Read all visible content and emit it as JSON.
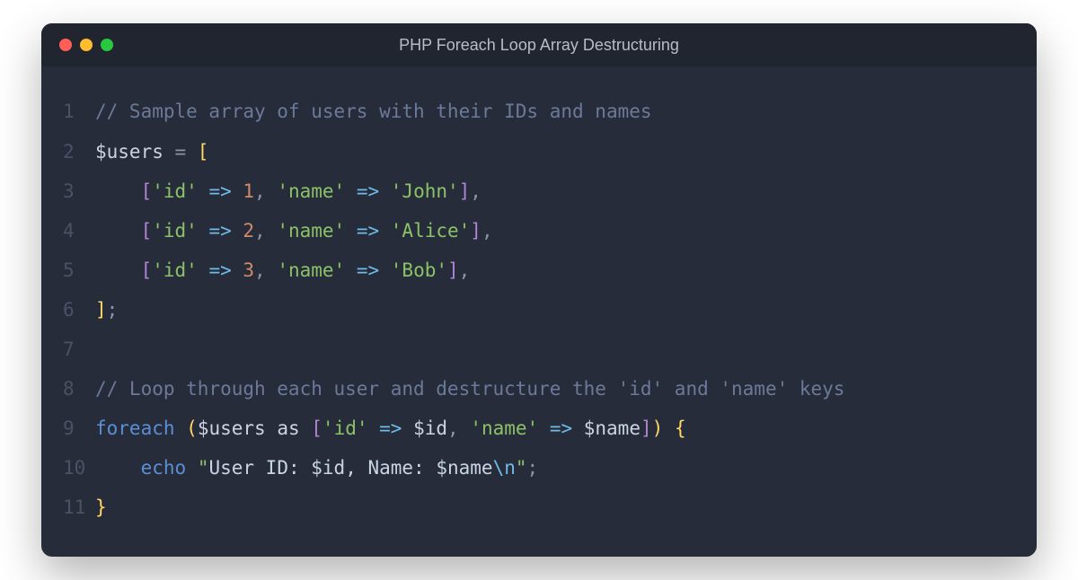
{
  "window": {
    "title": "PHP Foreach Loop Array Destructuring"
  },
  "lines": {
    "l1": {
      "num": "1",
      "comment": "// Sample array of users with their IDs and names"
    },
    "l2": {
      "num": "2",
      "var": "$users",
      "eq": " = ",
      "br": "["
    },
    "l3": {
      "num": "3",
      "indent": "    ",
      "lb": "[",
      "k1": "'id'",
      "ar": " => ",
      "v1": "1",
      "c1": ", ",
      "k2": "'name'",
      "v2": "'John'",
      "rb": "]",
      "end": ","
    },
    "l4": {
      "num": "4",
      "indent": "    ",
      "lb": "[",
      "k1": "'id'",
      "ar": " => ",
      "v1": "2",
      "c1": ", ",
      "k2": "'name'",
      "v2": "'Alice'",
      "rb": "]",
      "end": ","
    },
    "l5": {
      "num": "5",
      "indent": "    ",
      "lb": "[",
      "k1": "'id'",
      "ar": " => ",
      "v1": "3",
      "c1": ", ",
      "k2": "'name'",
      "v2": "'Bob'",
      "rb": "]",
      "end": ","
    },
    "l6": {
      "num": "6",
      "br": "]",
      "semi": ";"
    },
    "l7": {
      "num": "7"
    },
    "l8": {
      "num": "8",
      "comment": "// Loop through each user and destructure the 'id' and 'name' keys"
    },
    "l9": {
      "num": "9",
      "kw": "foreach",
      "sp": " ",
      "lp": "(",
      "var": "$users",
      "as": " as ",
      "lb": "[",
      "k1": "'id'",
      "ar": " => ",
      "v1": "$id",
      "c1": ", ",
      "k2": "'name'",
      "v2": "$name",
      "rb": "]",
      "rp": ")",
      "sp2": " ",
      "lc": "{"
    },
    "l10": {
      "num": "10",
      "indent": "    ",
      "kw": "echo",
      "sp": " ",
      "q": "\"",
      "s1": "User ID: ",
      "v1": "$id",
      "s2": ", Name: ",
      "v2": "$name",
      "esc": "\\n",
      "q2": "\"",
      "semi": ";"
    },
    "l11": {
      "num": "11",
      "rc": "}"
    }
  }
}
